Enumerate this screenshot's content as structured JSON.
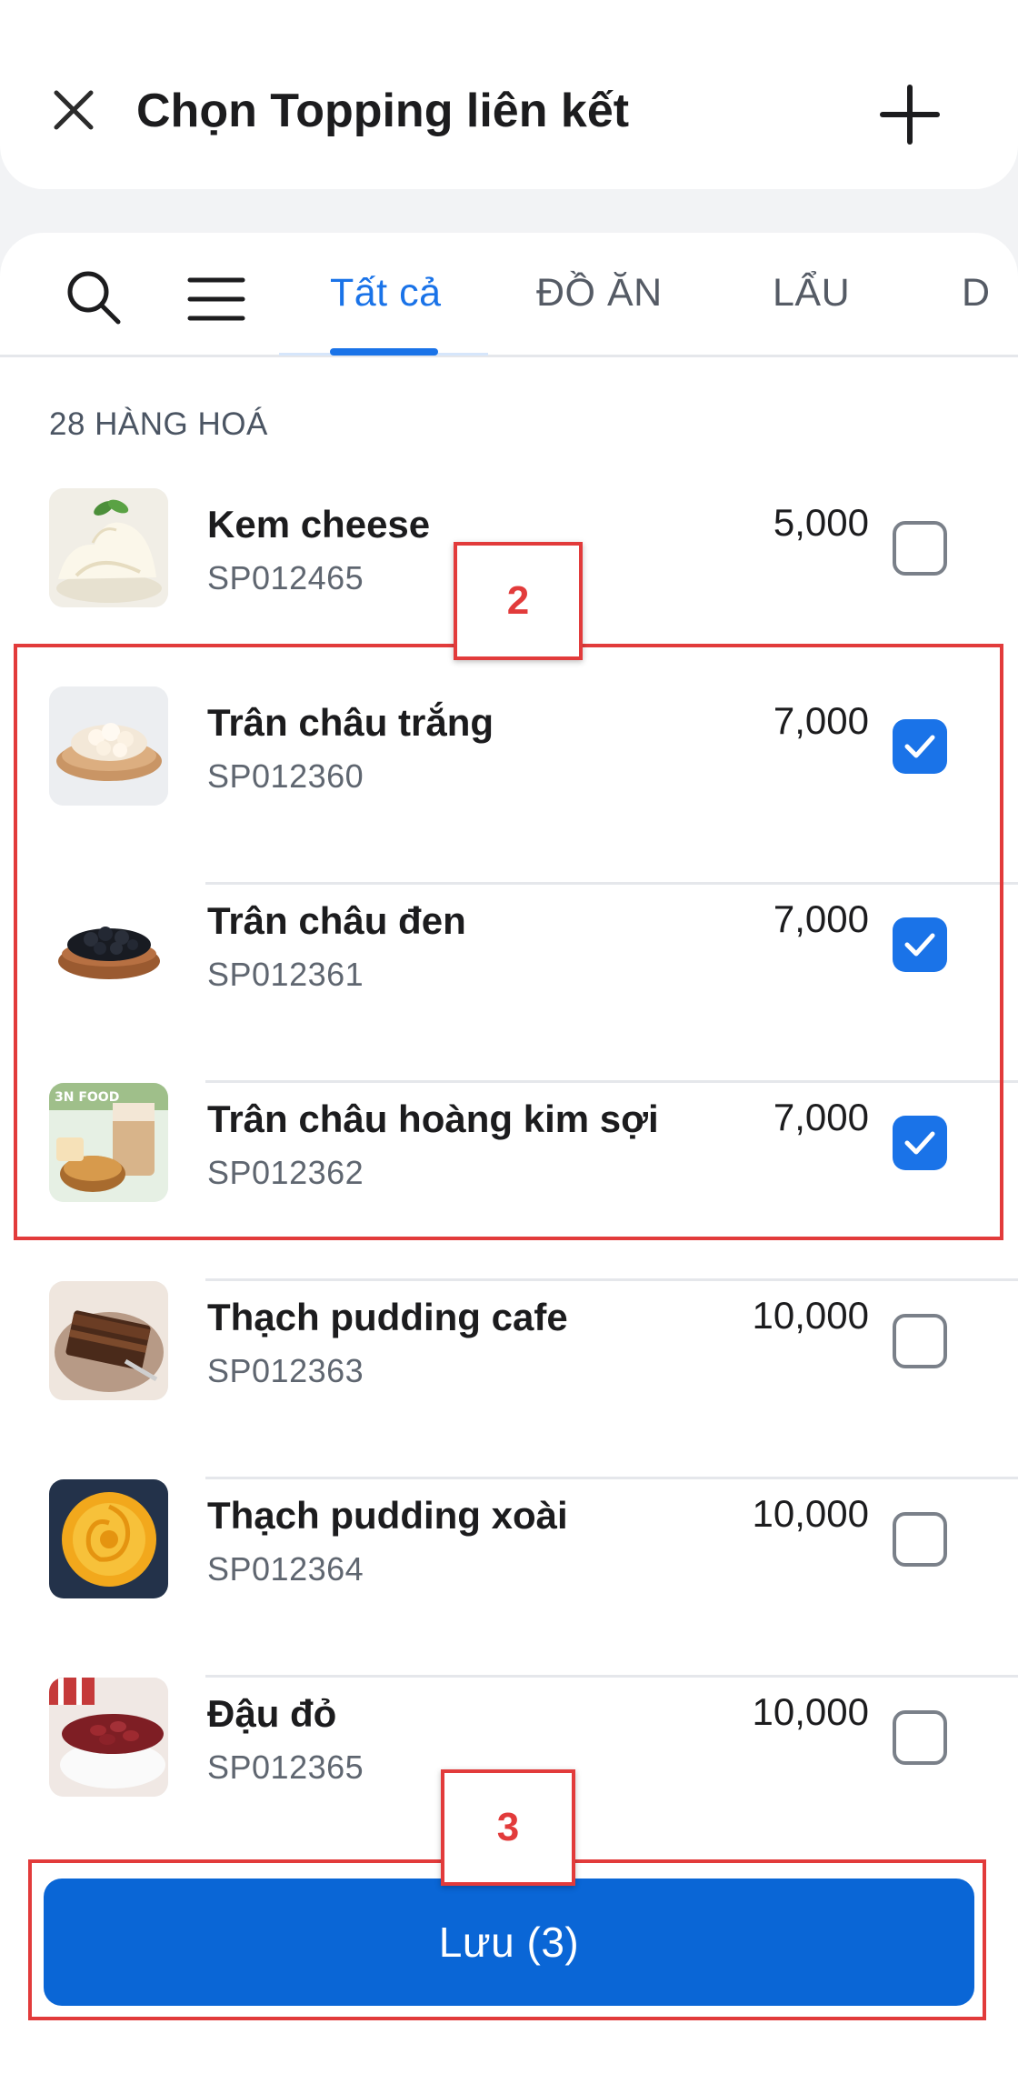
{
  "header": {
    "title": "Chọn Topping liên kết"
  },
  "tabs": [
    {
      "label": "Tất cả"
    },
    {
      "label": "ĐỒ ĂN"
    },
    {
      "label": "LẨU"
    },
    {
      "label": "D"
    }
  ],
  "list": {
    "count_label": "28 HÀNG HOÁ",
    "items": [
      {
        "name": "Kem cheese",
        "code": "SP012465",
        "price": "5,000",
        "checked": false
      },
      {
        "name": "Trân châu trắng",
        "code": "SP012360",
        "price": "7,000",
        "checked": true
      },
      {
        "name": "Trân châu đen",
        "code": "SP012361",
        "price": "7,000",
        "checked": true
      },
      {
        "name": "Trân châu hoàng kim sợi",
        "code": "SP012362",
        "price": "7,000",
        "checked": true
      },
      {
        "name": "Thạch pudding cafe",
        "code": "SP012363",
        "price": "10,000",
        "checked": false
      },
      {
        "name": "Thạch pudding xoài",
        "code": "SP012364",
        "price": "10,000",
        "checked": false
      },
      {
        "name": "Đậu đỏ",
        "code": "SP012365",
        "price": "10,000",
        "checked": false
      }
    ]
  },
  "thumb_badge": "3N FOOD",
  "annotations": {
    "selection_label": "2",
    "save_label": "3"
  },
  "footer": {
    "save_label": "Lưu (3)"
  },
  "colors": {
    "accent": "#1a73e8",
    "annotation": "#e23b3b",
    "primary_button": "#0a66d6"
  }
}
